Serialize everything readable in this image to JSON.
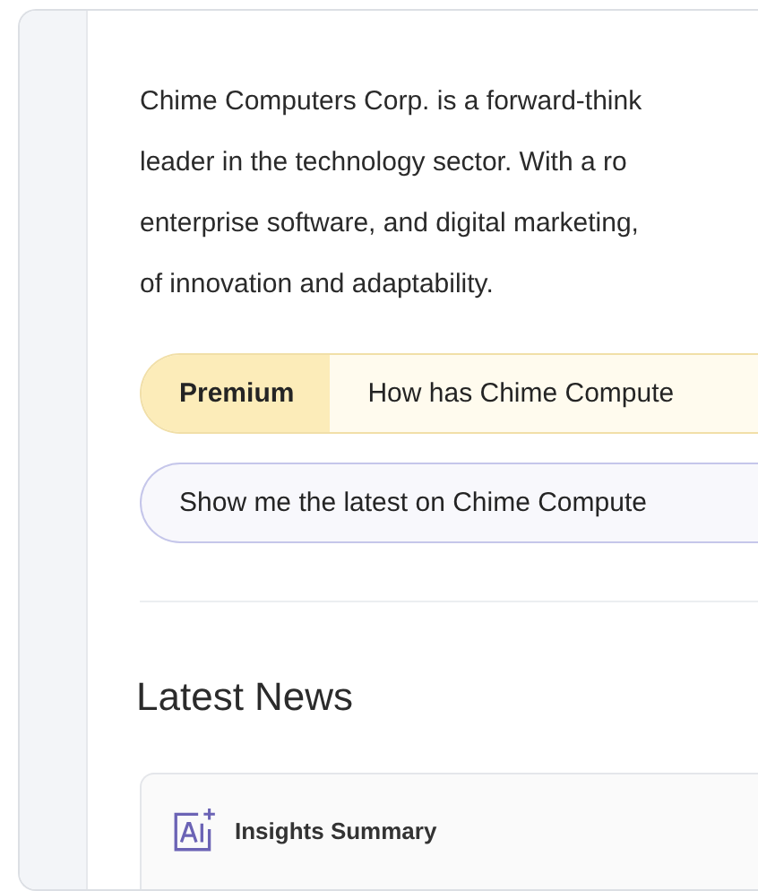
{
  "summary": {
    "lines": [
      "Chime Computers Corp. is a forward-think",
      "leader in the technology sector. With a ro",
      "enterprise software, and digital marketing,",
      "of innovation and adaptability."
    ]
  },
  "prompts": [
    {
      "kind": "premium",
      "badge": "Premium",
      "text": "How has Chime Compute"
    },
    {
      "kind": "plain",
      "text": "Show me the latest on Chime Compute"
    }
  ],
  "news": {
    "heading": "Latest News",
    "card": {
      "title": "Insights Summary"
    }
  }
}
